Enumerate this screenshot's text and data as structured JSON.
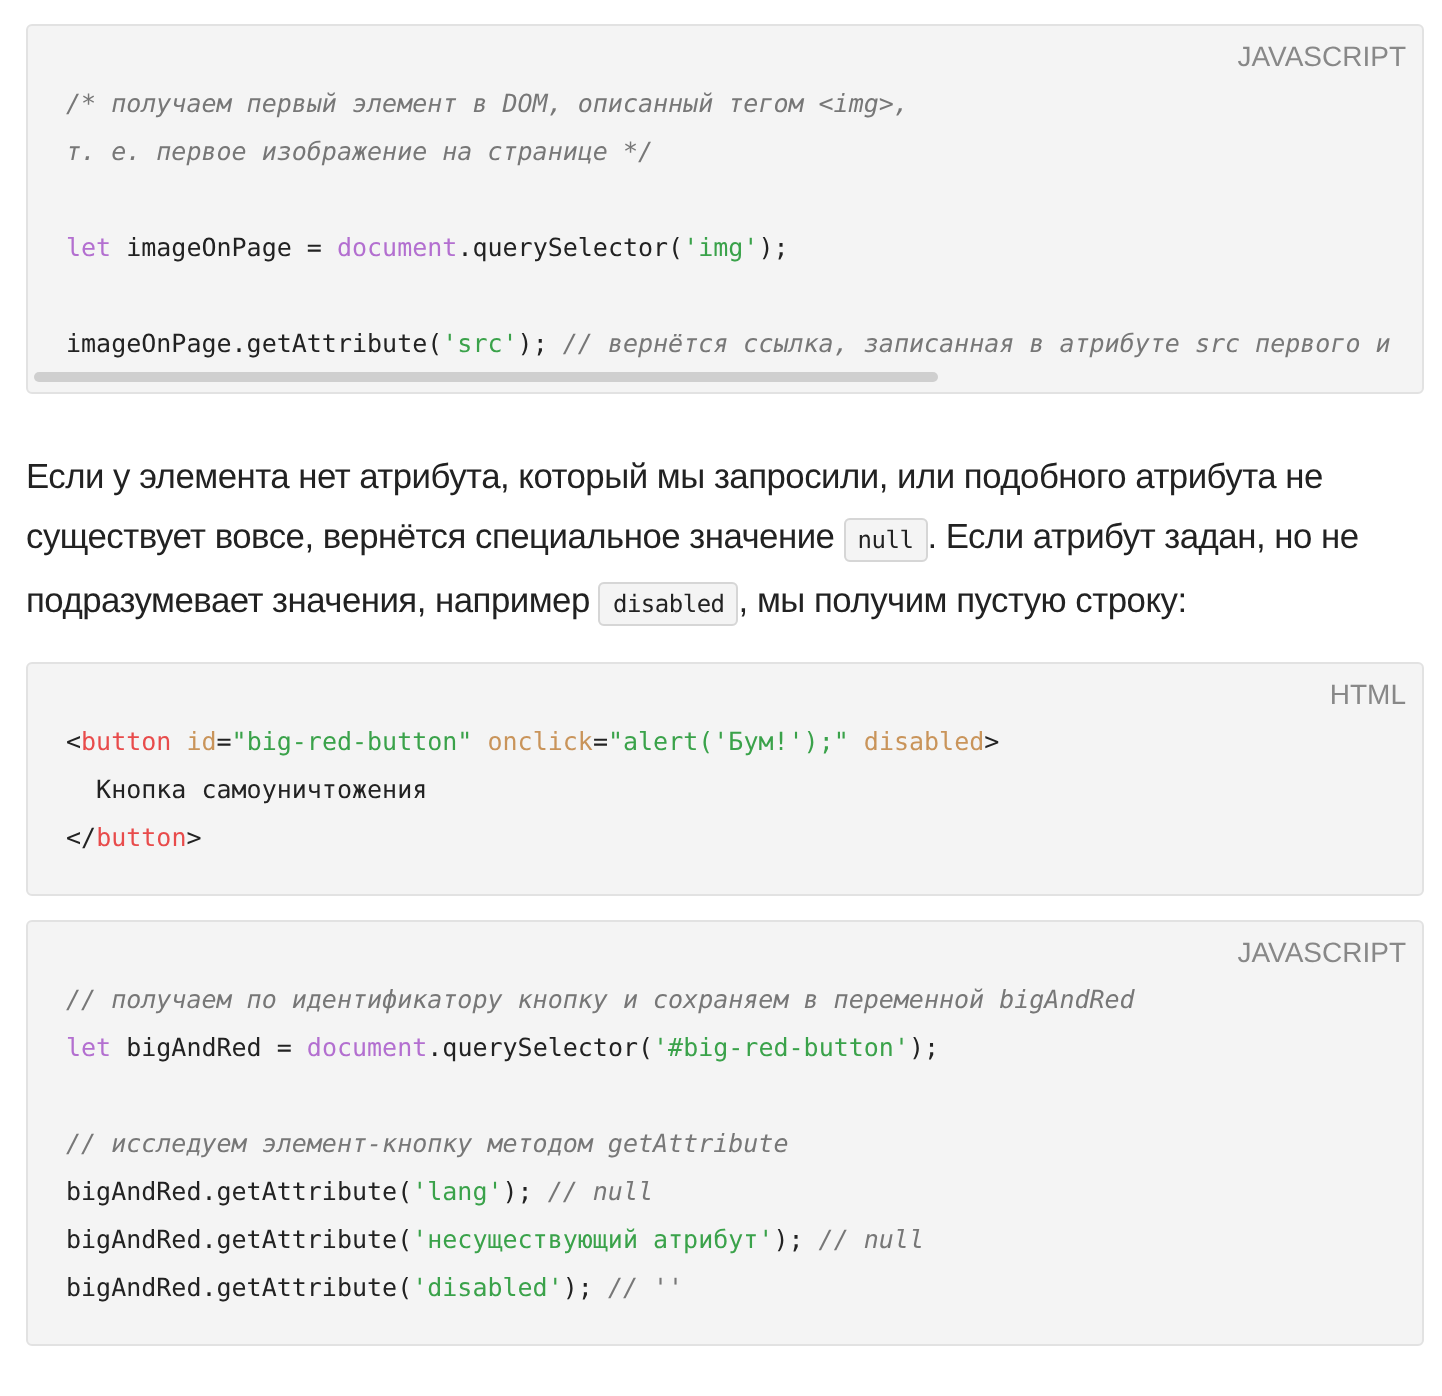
{
  "blocks_before": [
    {
      "language": "JAVASCRIPT",
      "scrollable": true,
      "lines": [
        {
          "kind": "code",
          "tokens": [
            {
              "kind": "comment",
              "text": "/* получаем первый элемент в DOM, описанный тегом <img>,"
            }
          ]
        },
        {
          "kind": "code",
          "tokens": [
            {
              "kind": "comment",
              "text": "т. е. первое изображение на странице */"
            }
          ]
        },
        {
          "kind": "blank"
        },
        {
          "kind": "code",
          "tokens": [
            {
              "kind": "keyword",
              "text": "let"
            },
            {
              "kind": "plain",
              "text": " imageOnPage = "
            },
            {
              "kind": "keyword",
              "text": "document"
            },
            {
              "kind": "plain",
              "text": ".querySelector("
            },
            {
              "kind": "string",
              "text": "'img'"
            },
            {
              "kind": "plain",
              "text": ");"
            }
          ]
        },
        {
          "kind": "blank"
        },
        {
          "kind": "code",
          "tokens": [
            {
              "kind": "plain",
              "text": "imageOnPage.getAttribute("
            },
            {
              "kind": "string",
              "text": "'src'"
            },
            {
              "kind": "plain",
              "text": "); "
            },
            {
              "kind": "comment",
              "text": "// вернётся ссылка, записанная в атрибуте src первого и"
            }
          ]
        }
      ]
    }
  ],
  "paragraph": [
    {
      "kind": "text",
      "text": "Если у элемента нет атрибута, который мы запросили, или подобного атрибута не существует вовсе, вернётся специальное значение "
    },
    {
      "kind": "code",
      "text": "null"
    },
    {
      "kind": "text",
      "text": ". Если атрибут задан, но не подразумевает значения, например "
    },
    {
      "kind": "code",
      "text": "disabled"
    },
    {
      "kind": "text",
      "text": ", мы получим пустую строку:"
    }
  ],
  "blocks_after": [
    {
      "language": "HTML",
      "scrollable": false,
      "lines": [
        {
          "kind": "code",
          "tokens": [
            {
              "kind": "plain",
              "text": "<"
            },
            {
              "kind": "tag",
              "text": "button"
            },
            {
              "kind": "attr",
              "text": " id"
            },
            {
              "kind": "plain",
              "text": "="
            },
            {
              "kind": "string",
              "text": "\"big-red-button\""
            },
            {
              "kind": "attr",
              "text": " onclick"
            },
            {
              "kind": "plain",
              "text": "="
            },
            {
              "kind": "string",
              "text": "\"alert('Бум!');\""
            },
            {
              "kind": "attr",
              "text": " disabled"
            },
            {
              "kind": "plain",
              "text": ">"
            }
          ]
        },
        {
          "kind": "code",
          "tokens": [
            {
              "kind": "plain",
              "text": "  Кнопка самоуничтожения"
            }
          ]
        },
        {
          "kind": "code",
          "tokens": [
            {
              "kind": "plain",
              "text": "</"
            },
            {
              "kind": "tag",
              "text": "button"
            },
            {
              "kind": "plain",
              "text": ">"
            }
          ]
        }
      ]
    },
    {
      "language": "JAVASCRIPT",
      "scrollable": false,
      "lines": [
        {
          "kind": "code",
          "tokens": [
            {
              "kind": "comment",
              "text": "// получаем по идентификатору кнопку и сохраняем в переменной bigAndRed"
            }
          ]
        },
        {
          "kind": "code",
          "tokens": [
            {
              "kind": "keyword",
              "text": "let"
            },
            {
              "kind": "plain",
              "text": " bigAndRed = "
            },
            {
              "kind": "keyword",
              "text": "document"
            },
            {
              "kind": "plain",
              "text": ".querySelector("
            },
            {
              "kind": "string",
              "text": "'#big-red-button'"
            },
            {
              "kind": "plain",
              "text": ");"
            }
          ]
        },
        {
          "kind": "blank"
        },
        {
          "kind": "code",
          "tokens": [
            {
              "kind": "comment",
              "text": "// исследуем элемент-кнопку методом getAttribute"
            }
          ]
        },
        {
          "kind": "code",
          "tokens": [
            {
              "kind": "plain",
              "text": "bigAndRed.getAttribute("
            },
            {
              "kind": "string",
              "text": "'lang'"
            },
            {
              "kind": "plain",
              "text": "); "
            },
            {
              "kind": "comment",
              "text": "// null"
            }
          ]
        },
        {
          "kind": "code",
          "tokens": [
            {
              "kind": "plain",
              "text": "bigAndRed.getAttribute("
            },
            {
              "kind": "string",
              "text": "'несуществующий атрибут'"
            },
            {
              "kind": "plain",
              "text": "); "
            },
            {
              "kind": "comment",
              "text": "// null"
            }
          ]
        },
        {
          "kind": "code",
          "tokens": [
            {
              "kind": "plain",
              "text": "bigAndRed.getAttribute("
            },
            {
              "kind": "string",
              "text": "'disabled'"
            },
            {
              "kind": "plain",
              "text": "); "
            },
            {
              "kind": "comment",
              "text": "// ''"
            }
          ]
        }
      ]
    }
  ]
}
